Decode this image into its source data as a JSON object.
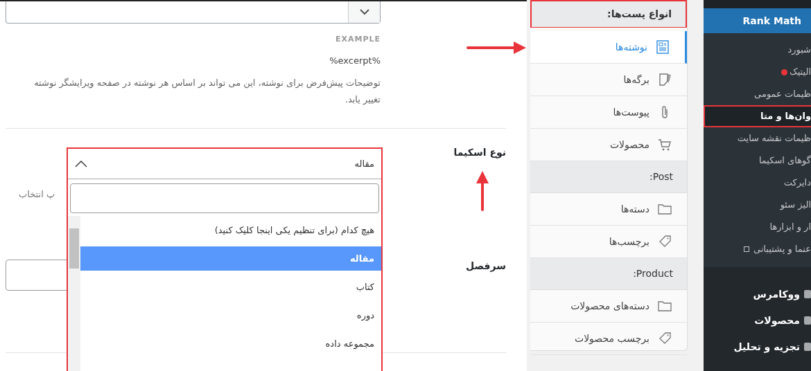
{
  "description": {
    "example_label": "EXAMPLE",
    "example_value": "%excerpt%",
    "help": "توضیحات پیش‌فرض برای نوشته، این می تواند بر اساس هر نوشته در صفحه ویرایشگر نوشته تغییر یابد."
  },
  "schema_type": {
    "label": "نوع اسکیما",
    "hidden_hint": "پ انتخاب",
    "highlighted": true,
    "dropdown": {
      "value": "مقاله",
      "expanded": true,
      "options": [
        {
          "label": "هیچ کدام (برای تنظیم یکی اینجا کلیک کنید)",
          "selected": false
        },
        {
          "label": "مقاله",
          "selected": true
        },
        {
          "label": "کتاب",
          "selected": false
        },
        {
          "label": "دوره",
          "selected": false
        },
        {
          "label": "مجموعه داده",
          "selected": false
        }
      ]
    }
  },
  "headline": {
    "label": "سرفصل"
  },
  "post_types_panel": {
    "sections": [
      {
        "title": "انواع پست‌ها:",
        "highlighted": true,
        "items": [
          {
            "label": "نوشته‌ها",
            "kind": "document",
            "selected": true
          },
          {
            "label": "برگه‌ها",
            "kind": "page",
            "selected": false
          },
          {
            "label": "پیوست‌ها",
            "kind": "attachment",
            "selected": false
          },
          {
            "label": "محصولات",
            "kind": "cart",
            "selected": false
          }
        ]
      },
      {
        "title": "Post:",
        "highlighted": false,
        "items": [
          {
            "label": "دسته‌ها",
            "kind": "folder",
            "selected": false
          },
          {
            "label": "برچسب‌ها",
            "kind": "tag",
            "selected": false
          }
        ]
      },
      {
        "title": "Product:",
        "highlighted": false,
        "items": [
          {
            "label": "دسته‌های محصولات",
            "kind": "folder",
            "selected": false
          },
          {
            "label": "برچسب محصولات",
            "kind": "tag",
            "selected": false
          }
        ]
      }
    ]
  },
  "admin_menu": {
    "title": "Rank Math",
    "submenu": [
      {
        "label": "شبورد",
        "selected": false,
        "highlighted": false,
        "notification": false,
        "external": false
      },
      {
        "label": "الیتیک",
        "selected": false,
        "highlighted": false,
        "notification": true,
        "external": false
      },
      {
        "label": "ظیمات عمومی",
        "selected": false,
        "highlighted": false,
        "notification": false,
        "external": false
      },
      {
        "label": "وان‌ها و متا",
        "selected": true,
        "highlighted": true,
        "notification": false,
        "external": false
      },
      {
        "label": "ظیمات نقشه سایت",
        "selected": false,
        "highlighted": false,
        "notification": false,
        "external": false
      },
      {
        "label": "گوهای اسکیما",
        "selected": false,
        "highlighted": false,
        "notification": false,
        "external": false
      },
      {
        "label": "دایرکت",
        "selected": false,
        "highlighted": false,
        "notification": false,
        "external": false
      },
      {
        "label": "الیز سئو",
        "selected": false,
        "highlighted": false,
        "notification": false,
        "external": false
      },
      {
        "label": "ار و ابزارها",
        "selected": false,
        "highlighted": false,
        "notification": false,
        "external": false
      },
      {
        "label": "عنما و پشتیبانی",
        "selected": false,
        "highlighted": false,
        "notification": false,
        "external": true
      }
    ],
    "main_items": [
      {
        "label": "ووکامرس"
      },
      {
        "label": "محصولات"
      },
      {
        "label": "تجزیه و تحلیل"
      }
    ]
  }
}
